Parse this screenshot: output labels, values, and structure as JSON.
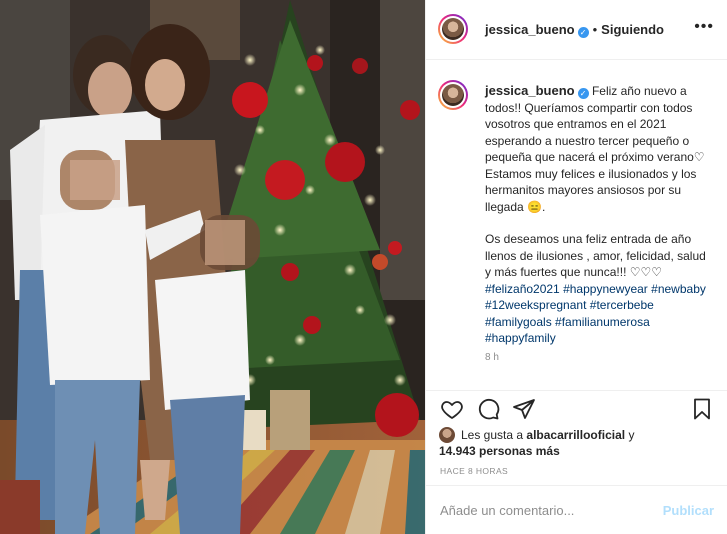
{
  "post": {
    "username": "jessica_bueno",
    "follow_status": "Siguiendo",
    "more_icon": "more-options-icon"
  },
  "caption": {
    "username": "jessica_bueno",
    "text_1": "Feliz año nuevo a todos!! Queríamos compartir con todos vosotros que entramos en el 2021 esperando a nuestro tercer pequeño o pequeña que nacerá el próximo verano♡ Estamos muy felices e ilusionados y los hermanitos mayores ansiosos por su llegada 😑.",
    "text_2": "Os deseamos una feliz entrada de año llenos de ilusiones , amor, felicidad, salud y más fuertes que nunca!!! ♡♡♡",
    "hashtags": [
      "#felizaño2021",
      "#happynewyear",
      "#newbaby",
      "#12weekspregnant",
      "#tercerbebe",
      "#familygoals",
      "#familianumerosa",
      "#happyfamily"
    ],
    "time": "8 h"
  },
  "actions": {
    "like_icon": "heart-icon",
    "comment_icon": "comment-icon",
    "share_icon": "share-icon",
    "save_icon": "bookmark-icon"
  },
  "likes": {
    "prefix": "Les gusta a",
    "user": "albacarrillooficial",
    "conjunction": "y",
    "count_text": "14.943 personas más"
  },
  "timestamp": "HACE 8 HORAS",
  "comment": {
    "placeholder": "Añade un comentario...",
    "publish_label": "Publicar"
  },
  "colors": {
    "link": "#00376b",
    "verified": "#3897f0",
    "publish_disabled": "#b2dffc",
    "secondary_text": "#8e8e8e"
  }
}
